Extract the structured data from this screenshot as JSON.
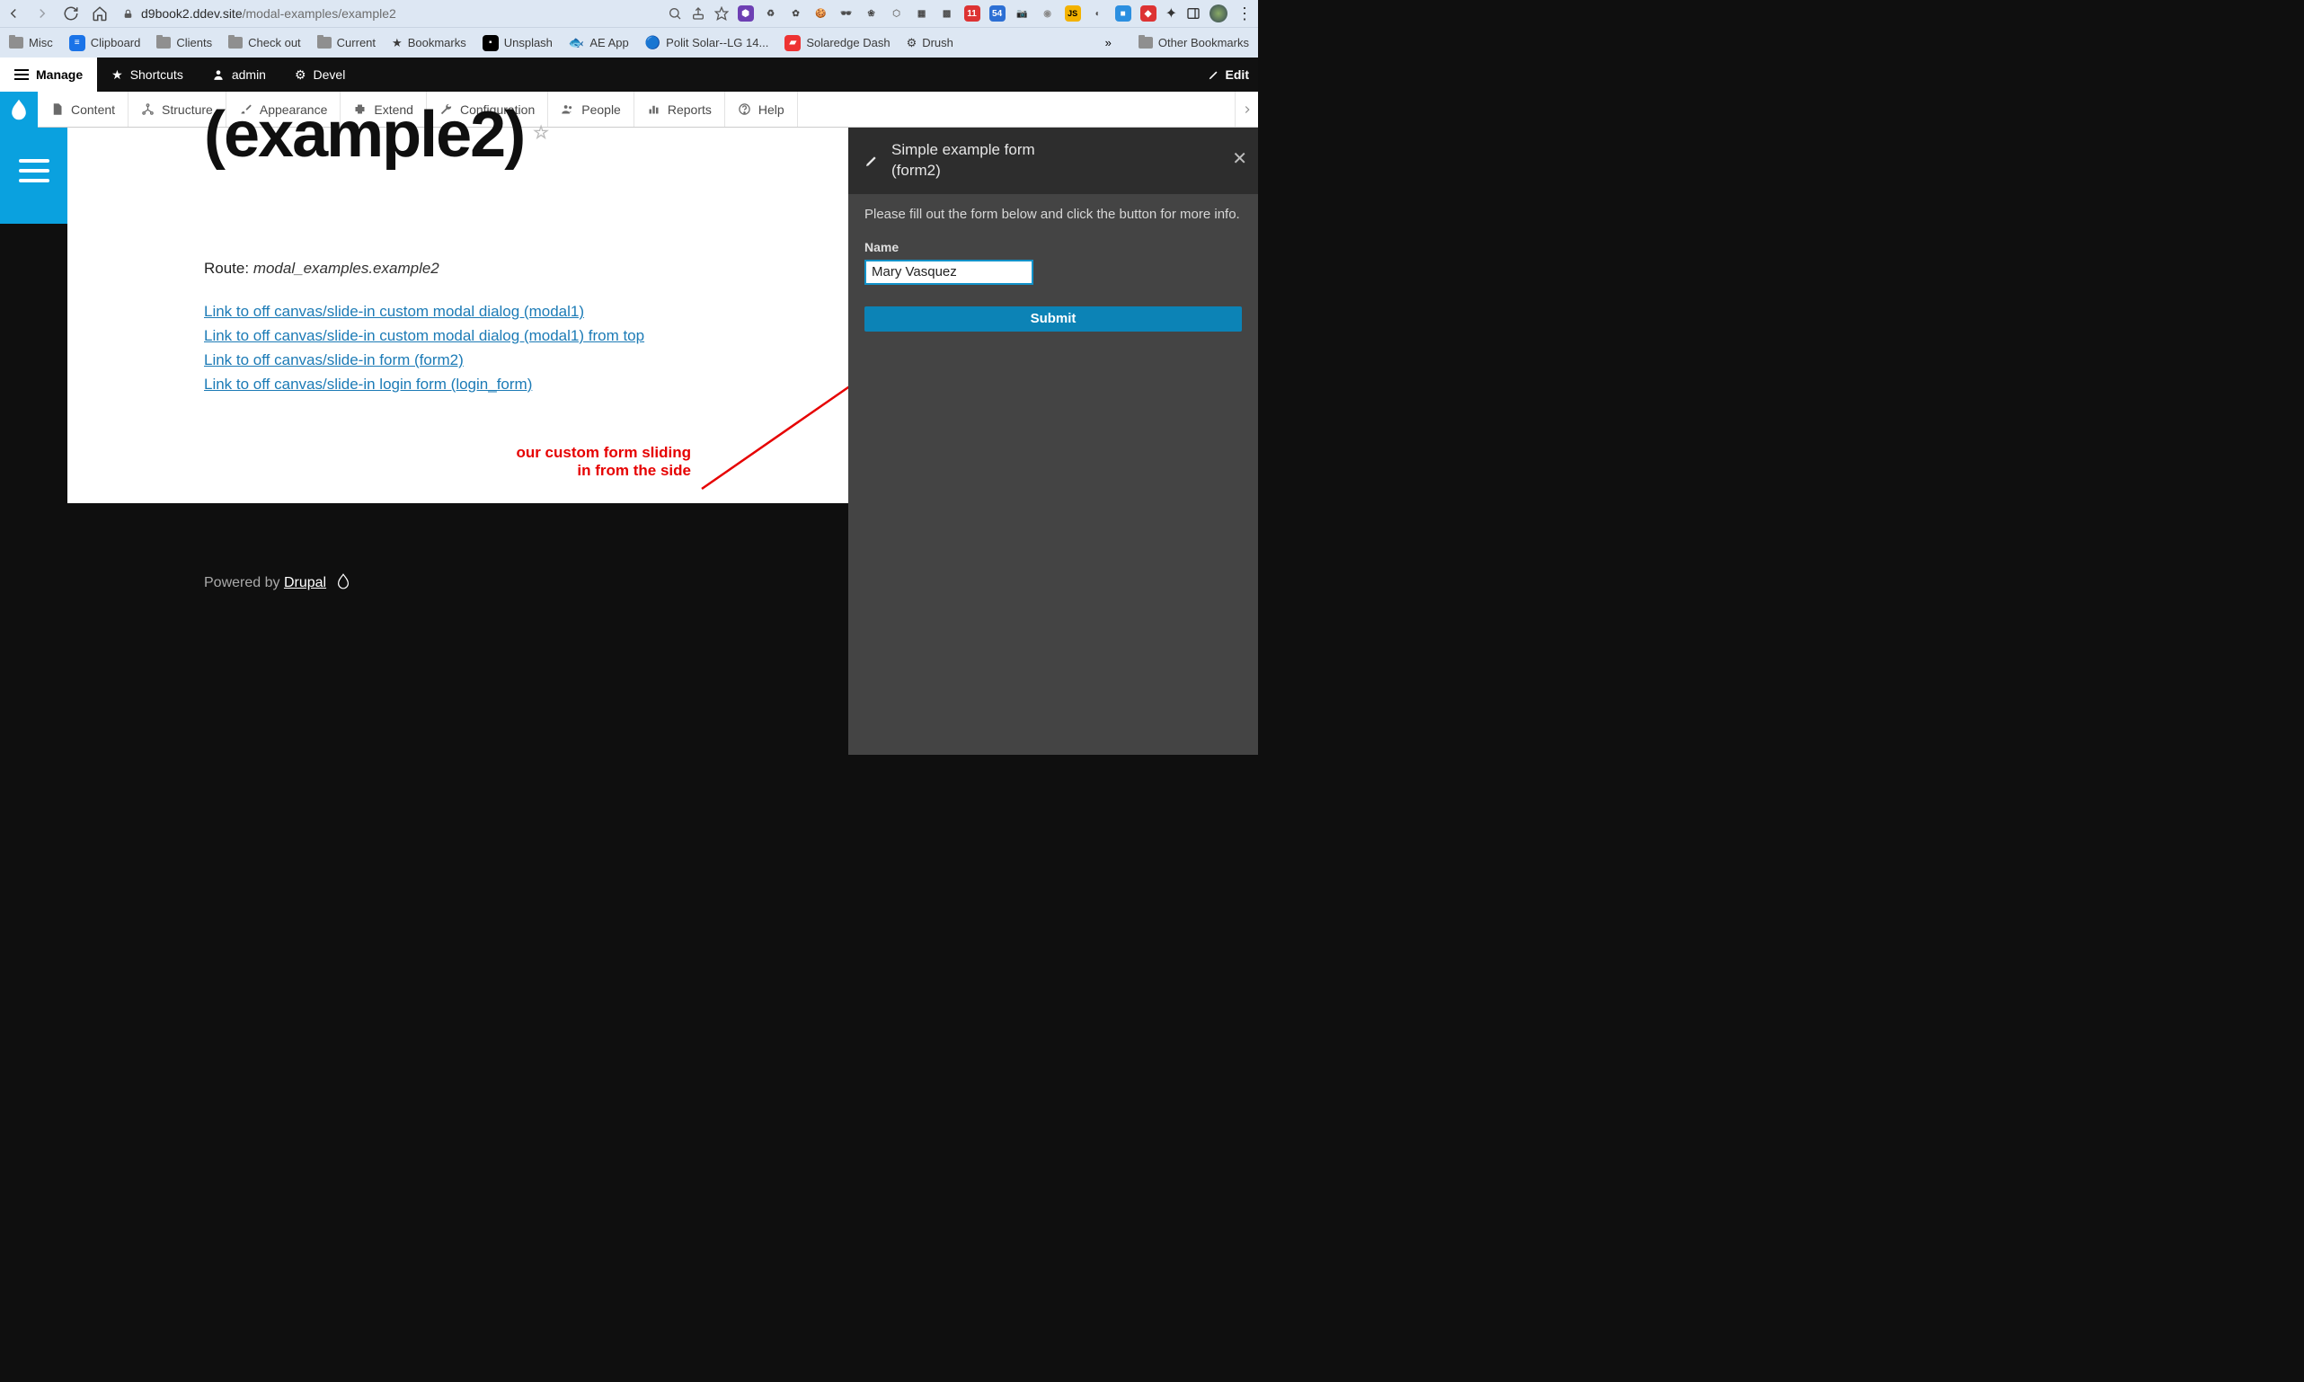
{
  "browser": {
    "url_host": "d9book2.ddev.site",
    "url_path": "/modal-examples/example2",
    "ext_badges": {
      "a": "11",
      "b": "54"
    }
  },
  "bookmarks": {
    "items": [
      {
        "label": "Misc"
      },
      {
        "label": "Clipboard"
      },
      {
        "label": "Clients"
      },
      {
        "label": "Check out"
      },
      {
        "label": "Current"
      },
      {
        "label": "Bookmarks"
      },
      {
        "label": "Unsplash"
      },
      {
        "label": "AE App"
      },
      {
        "label": "Polit Solar--LG 14..."
      },
      {
        "label": "Solaredge Dash"
      },
      {
        "label": "Drush"
      }
    ],
    "overflow": "»",
    "other": "Other Bookmarks"
  },
  "admin_toolbar": {
    "manage": "Manage",
    "shortcuts": "Shortcuts",
    "user": "admin",
    "devel": "Devel",
    "edit": "Edit"
  },
  "admin_menu": {
    "items": [
      {
        "label": "Content"
      },
      {
        "label": "Structure"
      },
      {
        "label": "Appearance"
      },
      {
        "label": "Extend"
      },
      {
        "label": "Configuration"
      },
      {
        "label": "People"
      },
      {
        "label": "Reports"
      },
      {
        "label": "Help"
      }
    ]
  },
  "page": {
    "title_visible": "(example2)",
    "route_prefix": "Route: ",
    "route": "modal_examples.example2",
    "links": [
      "Link to off canvas/slide-in custom modal dialog (modal1)",
      "Link to off canvas/slide-in custom modal dialog (modal1) from top",
      "Link to off canvas/slide-in form (form2)",
      "Link to off canvas/slide-in login form (login_form)"
    ],
    "annotation_line1": "our custom form sliding",
    "annotation_line2": "in from the side"
  },
  "footer": {
    "powered_by": "Powered by ",
    "drupal": "Drupal"
  },
  "offcanvas": {
    "title_line1": "Simple example form",
    "title_line2": "(form2)",
    "description": "Please fill out the form below and click the button for more info.",
    "name_label": "Name",
    "name_value": "Mary Vasquez",
    "submit": "Submit"
  }
}
